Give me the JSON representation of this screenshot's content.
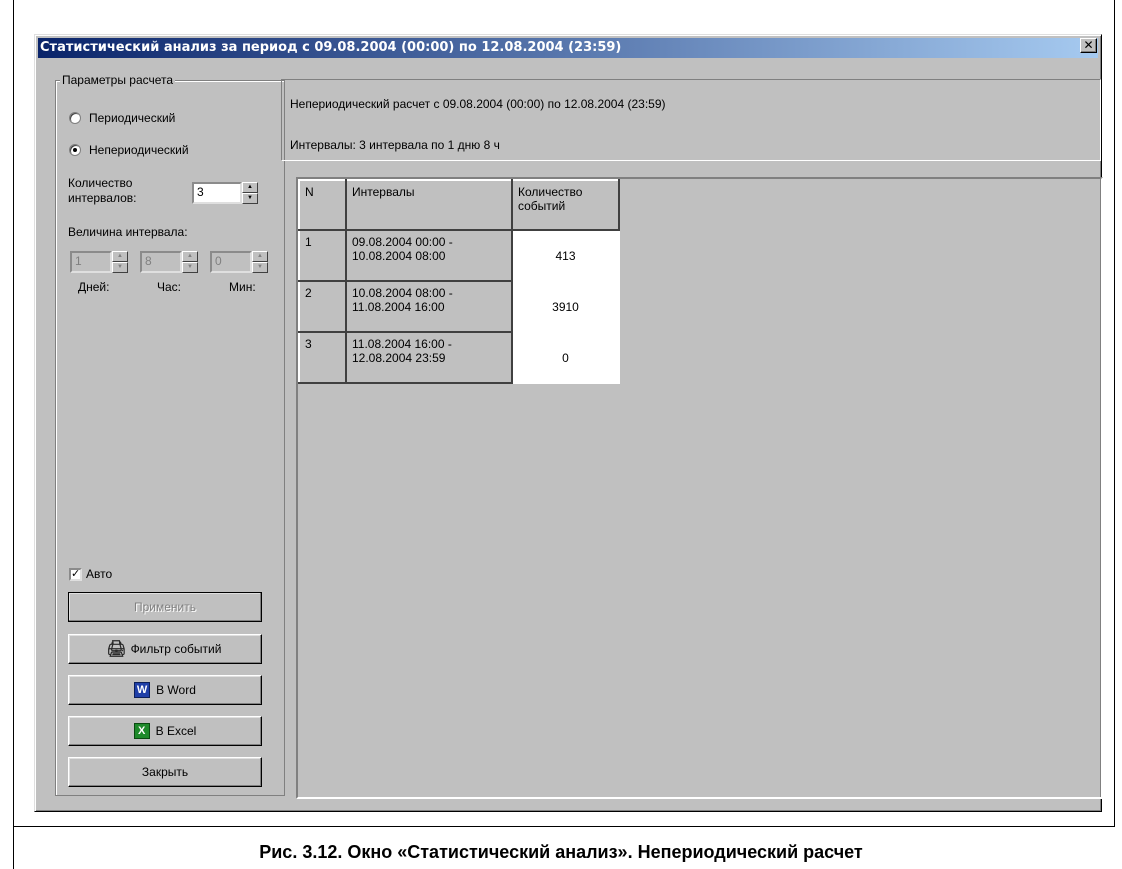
{
  "window": {
    "title": "Статистический анализ за период с 09.08.2004 (00:00) по 12.08.2004 (23:59)",
    "close_symbol": "✕"
  },
  "params": {
    "legend": "Параметры расчета",
    "radio_periodic": "Периодический",
    "radio_nonperiodic": "Непериодический",
    "selected": "Непериодический",
    "count_label_1": "Количество",
    "count_label_2": "интервалов:",
    "count_value": "3",
    "size_label": "Величина интервала:",
    "days_value": "1",
    "hours_value": "8",
    "mins_value": "0",
    "days_label": "Дней:",
    "hours_label": "Час:",
    "mins_label": "Мин:",
    "auto_label": "Авто",
    "auto_checked": true
  },
  "buttons": {
    "apply": "Применить",
    "filter": "Фильтр событий",
    "word": "В Word",
    "excel": "В Excel",
    "close": "Закрыть"
  },
  "info": {
    "line1": "Непериодический расчет с 09.08.2004 (00:00) по 12.08.2004 (23:59)",
    "line2": "Интервалы: 3 интервала по 1 дню 8 ч"
  },
  "table": {
    "headers": [
      "N",
      "Интервалы",
      "Количество событий"
    ],
    "rows": [
      {
        "n": "1",
        "interval_1": "09.08.2004 00:00 -",
        "interval_2": "10.08.2004 08:00",
        "count": "413"
      },
      {
        "n": "2",
        "interval_1": "10.08.2004 08:00 -",
        "interval_2": "11.08.2004 16:00",
        "count": "3910"
      },
      {
        "n": "3",
        "interval_1": "11.08.2004 16:00 -",
        "interval_2": "12.08.2004 23:59",
        "count": "0"
      }
    ]
  },
  "caption": "Рис. 3.12. Окно «Статистический анализ». Непериодический расчет",
  "icons": [
    "close-icon",
    "printer-icon",
    "word-icon",
    "excel-icon",
    "check-icon"
  ]
}
